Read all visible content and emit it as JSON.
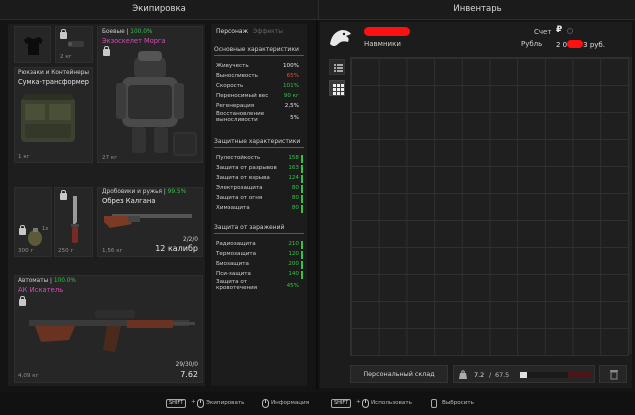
{
  "header": {
    "equipment_title": "Экипировка",
    "inventory_title": "Инвентарь"
  },
  "equipment": {
    "top_small": {
      "weight": "2 кг"
    },
    "armor": {
      "category": "Боевые",
      "percent": "100.0%",
      "name": "Экзоскелет Морга",
      "weight": "27 кг"
    },
    "backpack": {
      "category": "Рюкзаки и Контейнеры",
      "name": "Сумка-трансформер",
      "weight": "1 кг"
    },
    "grenade": {
      "weight": "300 г",
      "count": "1x"
    },
    "knife": {
      "weight": "250 г"
    },
    "shotgun": {
      "category": "Дробовики и ружья",
      "percent": "99.5%",
      "name": "Обрез Калгана",
      "ammo": "2/2/0",
      "caliber": "12 калибр",
      "weight": "1,56 кг"
    },
    "rifle": {
      "category": "Автоматы",
      "percent": "100.0%",
      "name": "АК Искатель",
      "ammo": "29/30/0",
      "caliber": "7.62",
      "weight": "4,09 кг"
    }
  },
  "stats": {
    "tabs": [
      "Персонаж",
      "Эффекты"
    ],
    "sections": {
      "basic": "Основные характеристики",
      "protective": "Защитные характеристики",
      "infection": "Защита от заражений"
    },
    "basic_rows": [
      {
        "label": "Живучесть",
        "value": "100%"
      },
      {
        "label": "Выносливость",
        "value": "65%"
      },
      {
        "label": "Скорость",
        "value": "101%"
      },
      {
        "label": "Переносимый вес",
        "value": "90 кг"
      },
      {
        "label": "Регенерация",
        "value": "2,5%"
      },
      {
        "label": "Восстановление выносливости",
        "value": "5%"
      }
    ],
    "protective_rows": [
      {
        "label": "Пулестойкость",
        "value": "158"
      },
      {
        "label": "Защита от разрывов",
        "value": "163"
      },
      {
        "label": "Защита от взрыва",
        "value": "124"
      },
      {
        "label": "Электрозащита",
        "value": "80"
      },
      {
        "label": "Защита от огня",
        "value": "80"
      },
      {
        "label": "Химзащита",
        "value": "80"
      }
    ],
    "infection_rows": [
      {
        "label": "Радиозащита",
        "value": "210"
      },
      {
        "label": "Термозащита",
        "value": "120"
      },
      {
        "label": "Биозащита",
        "value": "200"
      },
      {
        "label": "Пси-защита",
        "value": "140"
      },
      {
        "label": "Защита от кровотечения",
        "value": "45%"
      }
    ]
  },
  "inventory": {
    "player_rank": "Навмники",
    "account_label": "Счет",
    "currency_label": "Рубль",
    "currency_symbol": "₽",
    "money_prefix": "2 0",
    "money_suffix": "3 руб.",
    "storage_button": "Персональный склад",
    "weight_current": "7.2",
    "weight_max": "67.5"
  },
  "footer": {
    "key_shift": "SHIFT",
    "equip": "Экипировать",
    "info": "Информация",
    "use": "Использовать",
    "drop": "Выбросить"
  },
  "colors": {
    "accent_green": "#36c24a",
    "name_pink": "#d14fb5",
    "warn_red": "#e0503c",
    "bg": "#141414"
  }
}
